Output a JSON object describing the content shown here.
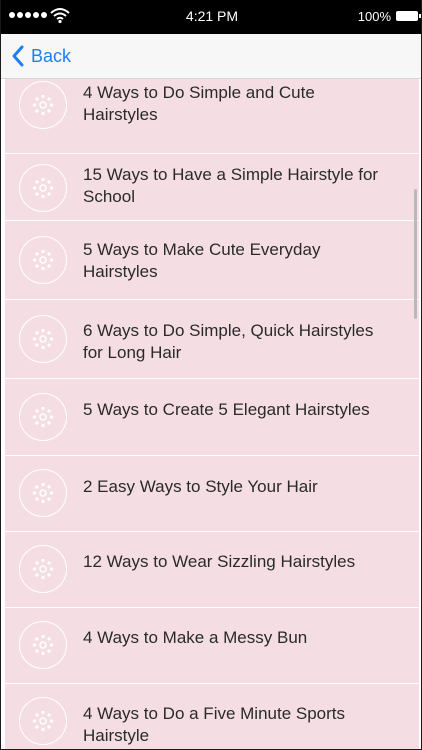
{
  "status_bar": {
    "time": "4:21 PM",
    "battery": "100%",
    "signal_icon": "signal-dots-icon",
    "wifi_icon": "wifi-icon",
    "battery_icon": "battery-icon"
  },
  "nav": {
    "back_label": "Back",
    "accent_color": "#1d7ff5"
  },
  "list": {
    "background": "#f4dee4",
    "item_icon": "flower-icon",
    "items": [
      {
        "title_line1": "4 Ways to Do Simple and Cute",
        "title_line2": "Hairstyles"
      },
      {
        "title_line1": "15 Ways to Have a Simple Hairstyle for",
        "title_line2": "School"
      },
      {
        "title_line1": "5 Ways to Make Cute Everyday",
        "title_line2": "Hairstyles"
      },
      {
        "title_line1": "6 Ways to Do Simple, Quick Hairstyles",
        "title_line2": "for Long Hair"
      },
      {
        "title_line1": "5 Ways to Create 5 Elegant Hairstyles",
        "title_line2": ""
      },
      {
        "title_line1": "2 Easy Ways to Style Your Hair",
        "title_line2": ""
      },
      {
        "title_line1": "12 Ways to Wear Sizzling Hairstyles",
        "title_line2": ""
      },
      {
        "title_line1": "4 Ways to Make a Messy Bun",
        "title_line2": ""
      },
      {
        "title_line1": "4 Ways to Do a Five Minute Sports",
        "title_line2": "Hairstyle"
      }
    ]
  }
}
